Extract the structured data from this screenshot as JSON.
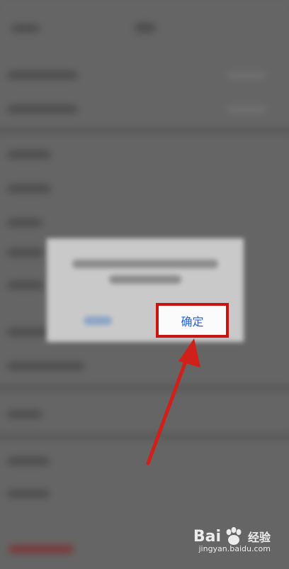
{
  "dialog": {
    "confirm_label": "确定"
  },
  "watermark": {
    "brand_prefix": "Bai",
    "brand_suffix": "经验",
    "url": "jingyan.baidu.com"
  },
  "colors": {
    "highlight_box": "#c9140f",
    "confirm_text": "#1e63d9"
  }
}
